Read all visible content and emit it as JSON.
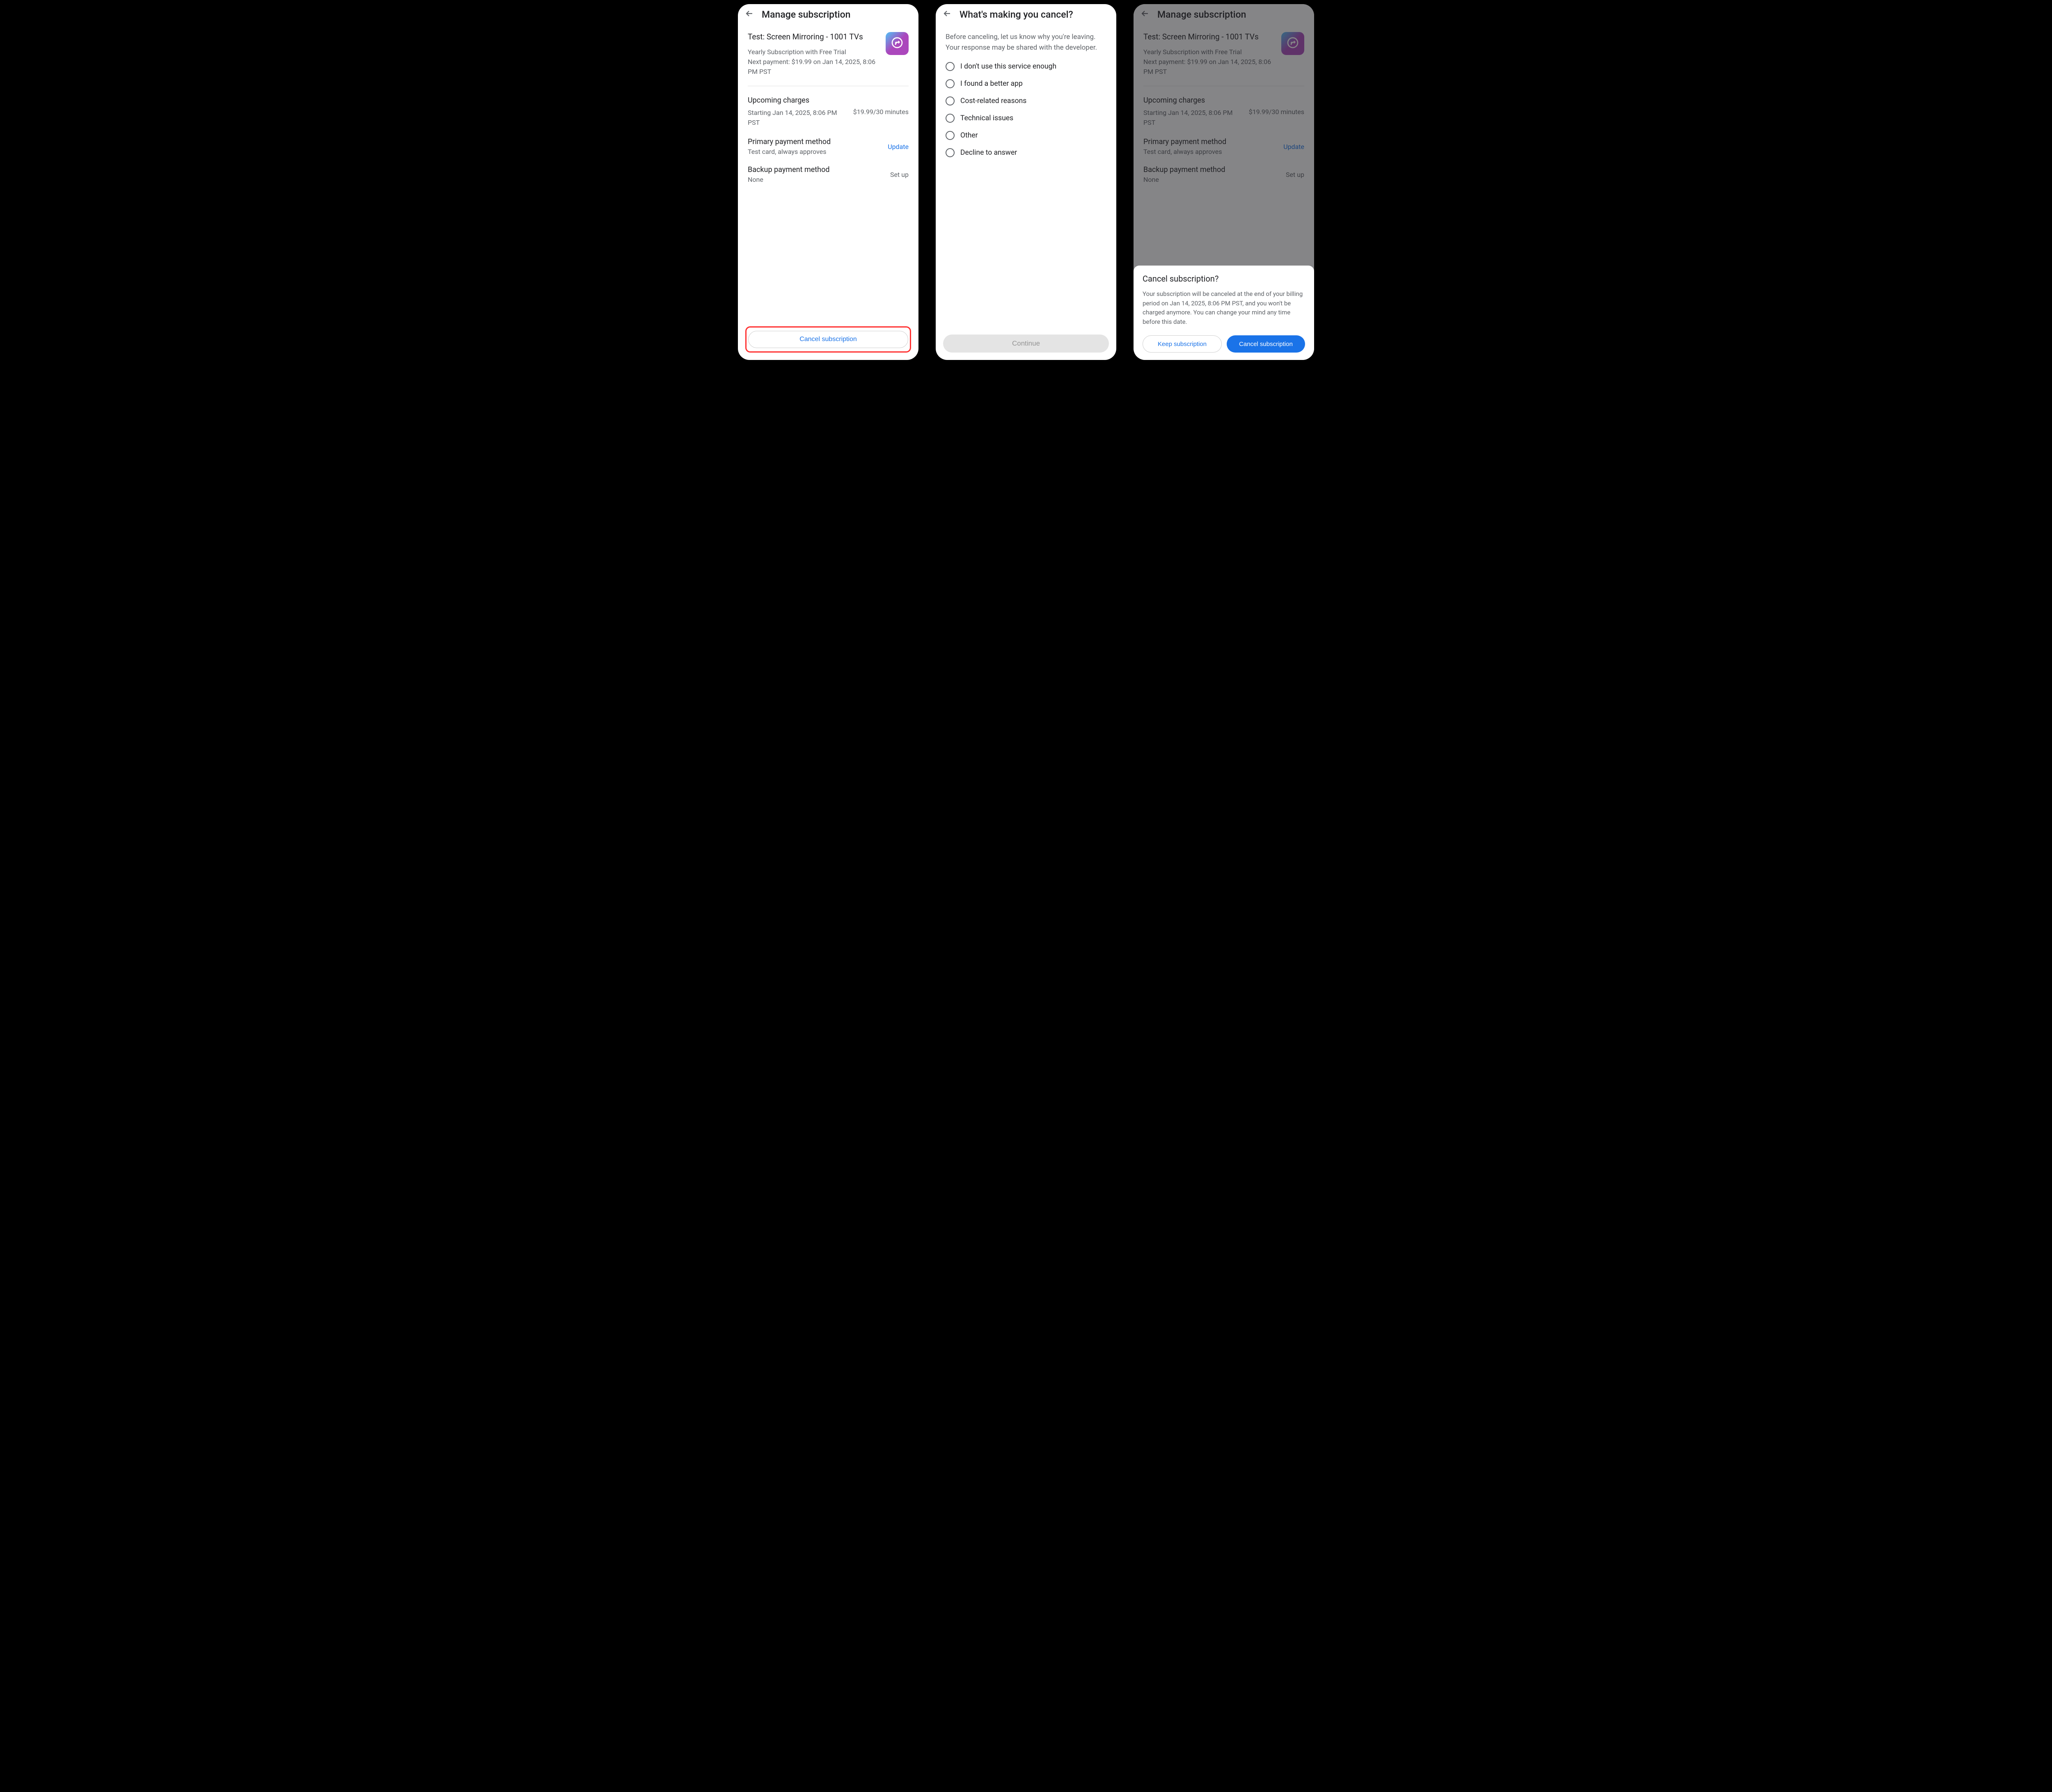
{
  "screen1": {
    "title": "Manage subscription",
    "sub_name": "Test: Screen Mirroring - 1001 TVs",
    "sub_plan": "Yearly Subscription with Free Trial",
    "sub_next_payment": "Next payment: $19.99 on Jan 14, 2025, 8:06 PM PST",
    "upcoming_heading": "Upcoming charges",
    "upcoming_start": "Starting Jan 14, 2025, 8:06 PM PST",
    "upcoming_price": "$19.99/30 minutes",
    "primary_heading": "Primary payment method",
    "primary_method": "Test card, always approves",
    "primary_action": "Update",
    "backup_heading": "Backup payment method",
    "backup_method": "None",
    "backup_action": "Set up",
    "cancel_button": "Cancel subscription"
  },
  "screen2": {
    "title": "What's making you cancel?",
    "intro": "Before canceling, let us know why you're leaving. Your response may be shared with the developer.",
    "options": [
      "I don't use this service enough",
      "I found a better app",
      "Cost-related reasons",
      "Technical issues",
      "Other",
      "Decline to answer"
    ],
    "continue": "Continue"
  },
  "screen3": {
    "title": "Manage subscription",
    "sheet_title": "Cancel subscription?",
    "sheet_body": "Your subscription will be canceled at the end of your billing period on Jan 14, 2025, 8:06 PM PST, and you won't be charged anymore. You can change your mind any time before this date.",
    "keep": "Keep subscription",
    "cancel": "Cancel subscription"
  }
}
